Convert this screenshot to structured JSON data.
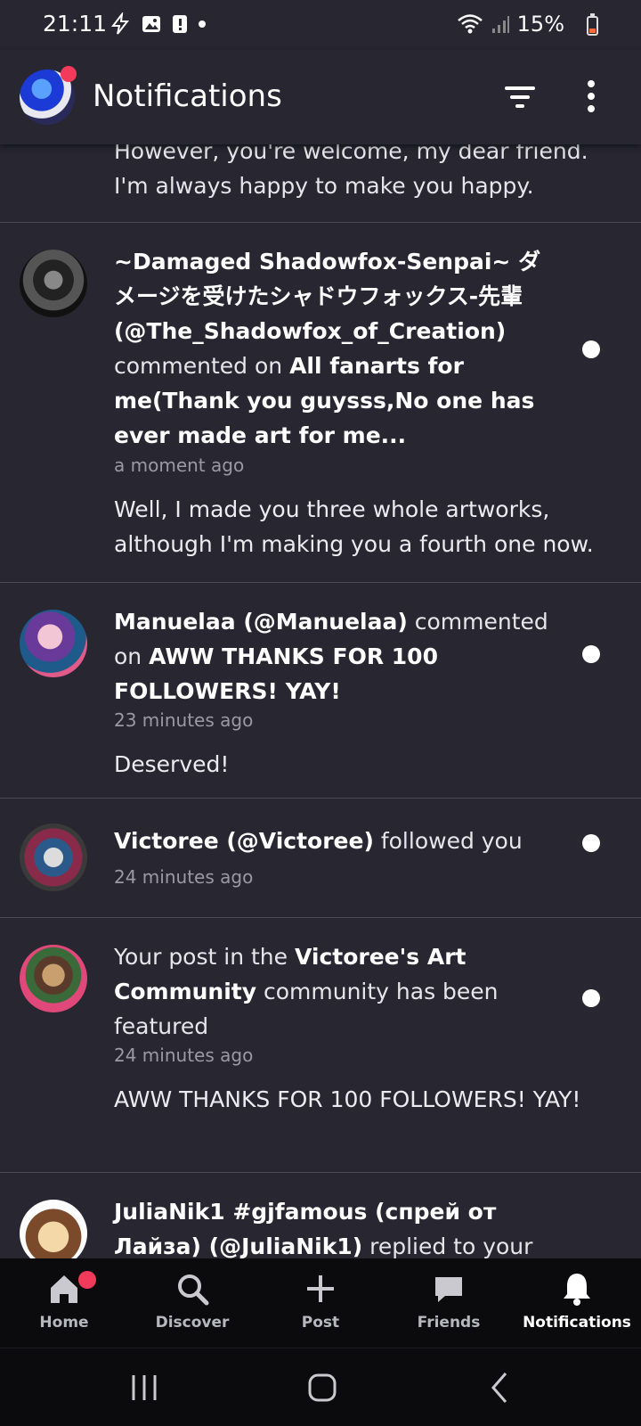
{
  "status_bar": {
    "time": "21:11",
    "battery": "15%"
  },
  "header": {
    "title": "Notifications"
  },
  "partial_item": {
    "text": "However, you're welcome, my dear friend. I'm always happy to make you happy."
  },
  "notifications": [
    {
      "actor": "~Damaged Shadowfox-Senpai~ ダメージを受けたシャドウフォックス-先輩 (@The_Shadowfox_of_Creation)",
      "action": " commented on ",
      "target": "All fanarts for me(Thank you guysss,No one has ever made art for me...",
      "time": "a moment ago",
      "comment": "Well, I made you three whole artworks, although I'm making you a fourth one now."
    },
    {
      "actor": "Manuelaa (@Manuelaa)",
      "action": " commented on ",
      "target": "AWW THANKS FOR 100 FOLLOWERS! YAY!",
      "time": "23 minutes ago",
      "comment": "Deserved!"
    },
    {
      "actor": "Victoree (@Victoree)",
      "action": " followed you",
      "time": "24 minutes ago"
    },
    {
      "prefix": "Your post in the ",
      "community": "Victoree's Art Community",
      "suffix": " community has been featured",
      "time": "24 minutes ago",
      "comment": "AWW THANKS FOR 100 FOLLOWERS! YAY!"
    },
    {
      "actor": "JuliaNik1 #gjfamous (спрей от Лайза) (@JuliaNik1)",
      "action": " replied to your"
    }
  ],
  "bottom_nav": [
    {
      "label": "Home",
      "icon": "home-icon"
    },
    {
      "label": "Discover",
      "icon": "search-icon"
    },
    {
      "label": "Post",
      "icon": "plus-icon"
    },
    {
      "label": "Friends",
      "icon": "chat-icon"
    },
    {
      "label": "Notifications",
      "icon": "bell-icon"
    }
  ],
  "colors": {
    "background": "#272631",
    "badge": "#f23a5a",
    "nav_background": "#0b0b0d"
  }
}
